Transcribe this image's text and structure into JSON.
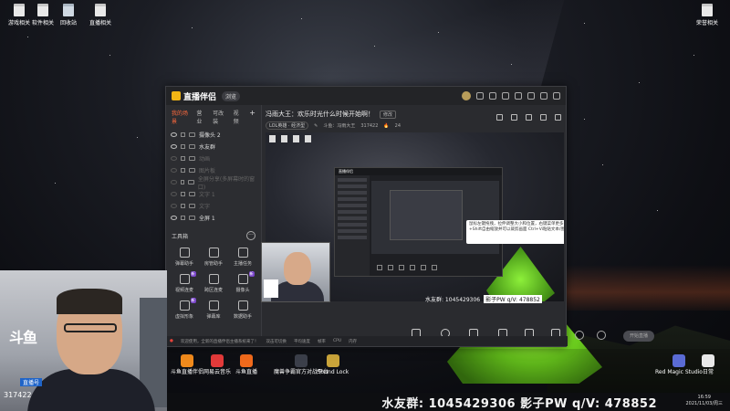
{
  "desktop": {
    "icons": [
      {
        "label": "游戏相关",
        "kind": "folder"
      },
      {
        "label": "软件相关",
        "kind": "folder"
      },
      {
        "label": "回收站",
        "kind": "bin"
      },
      {
        "label": "直播相关",
        "kind": "folder"
      }
    ],
    "right_icon": {
      "label": "荣誉相关"
    },
    "shortcuts": [
      {
        "label": "斗鱼直播伴侣",
        "color": "#f08a1c"
      },
      {
        "label": "网易云音乐",
        "color": "#e23a3a"
      },
      {
        "label": "斗鱼直播",
        "color": "#f06a1c"
      },
      {
        "label": "魔兽争霸官方对战平台",
        "color": "#3b3f4a"
      },
      {
        "label": "Sound Lock",
        "color": "#c9a43a"
      },
      {
        "label": "Red Magic Studio",
        "color": "#5a6bd4"
      },
      {
        "label": "日常",
        "color": "#e8e8e8"
      }
    ]
  },
  "app": {
    "name": "直播伴侣",
    "badge": "浏览",
    "tabs": [
      "我的场景",
      "营业",
      "可改装",
      "视频"
    ],
    "add_tab": "+",
    "scenes": [
      {
        "label": "摄像头 2",
        "visible": true
      },
      {
        "label": "水友群",
        "visible": true
      },
      {
        "label": "动画",
        "visible": false
      },
      {
        "label": "图片板",
        "visible": false
      },
      {
        "label": "全屏分享(多屏幕时的窗口)",
        "visible": false
      },
      {
        "label": "文字 1",
        "visible": false
      },
      {
        "label": "文字",
        "visible": false
      },
      {
        "label": "全屏 1",
        "visible": true
      }
    ],
    "tools_title": "工具箱",
    "tools_more": "···",
    "tools": [
      {
        "label": "弹幕助手",
        "badge": ""
      },
      {
        "label": "房管助手",
        "badge": ""
      },
      {
        "label": "主播任务",
        "badge": ""
      },
      {
        "label": "视频连麦",
        "badge": "新"
      },
      {
        "label": "跨区连麦",
        "badge": ""
      },
      {
        "label": "摄像头",
        "badge": "新"
      },
      {
        "label": "虚拟形象",
        "badge": "新"
      },
      {
        "label": "弹幕库",
        "badge": ""
      },
      {
        "label": "数据助手",
        "badge": ""
      }
    ],
    "room_title": "冯雨大王：欢乐时光什么时候开始啊！",
    "room_edit": "修改",
    "room_category": "LOL英雄 · 经济型",
    "room_owner": "斗鱼：冯雨大王",
    "room_number": "317422",
    "room_hot": "24",
    "tooltip": "鼠标左键拖拽，拉伸调整大小和位置，右键菜单更多 按住Alt键+Shift自由缩放并可以裁剪画面 Ctrl+Vi粘贴文本/图片",
    "watermark_text": "水友群: 1045429306",
    "watermark_pv": "影子PW q/V: 478852",
    "controls": [
      "直播屏幕",
      "摄像头",
      "手机投屏",
      "多媒体",
      "麦克风",
      "扬声器"
    ],
    "live_button": "开始直播",
    "status": [
      "欢迎使用，全新的直播伴侣主播系统来了！",
      "双击可切换",
      "平均速度",
      "帧率",
      "CPU",
      "内存"
    ]
  },
  "stream_overlay": {
    "logo_text": "斗鱼",
    "badge": "直播号",
    "room_id": "317422",
    "ticker": "水友群: 1045429306  影子PW q/V: 478852"
  },
  "clock": {
    "time": "16:59",
    "date": "2021/11/03/周三"
  }
}
